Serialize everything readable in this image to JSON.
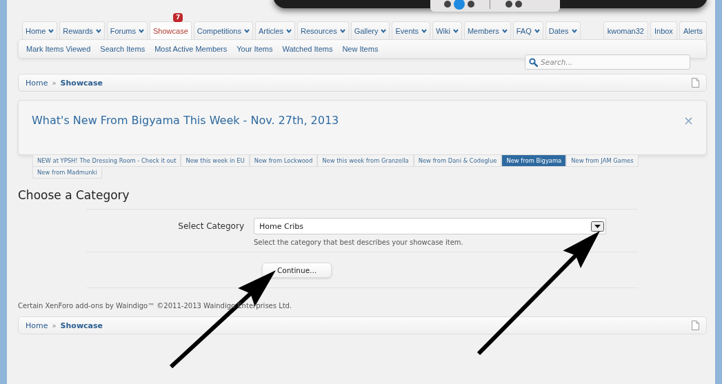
{
  "nav_tabs": [
    {
      "label": "Home",
      "has_menu": true,
      "selected": false
    },
    {
      "label": "Rewards",
      "has_menu": true,
      "selected": false
    },
    {
      "label": "Forums",
      "has_menu": true,
      "selected": false
    },
    {
      "label": "Showcase",
      "has_menu": false,
      "selected": true,
      "badge": "7"
    },
    {
      "label": "Competitions",
      "has_menu": true,
      "selected": false
    },
    {
      "label": "Articles",
      "has_menu": true,
      "selected": false
    },
    {
      "label": "Resources",
      "has_menu": true,
      "selected": false
    },
    {
      "label": "Gallery",
      "has_menu": true,
      "selected": false
    },
    {
      "label": "Events",
      "has_menu": true,
      "selected": false
    },
    {
      "label": "Wiki",
      "has_menu": true,
      "selected": false
    },
    {
      "label": "Members",
      "has_menu": true,
      "selected": false
    },
    {
      "label": "FAQ",
      "has_menu": true,
      "selected": false
    },
    {
      "label": "Dates",
      "has_menu": true,
      "selected": false
    }
  ],
  "account_tabs": [
    "kwoman32",
    "Inbox",
    "Alerts"
  ],
  "sub_nav": [
    "Mark Items Viewed",
    "Search Items",
    "Most Active Members",
    "Your Items",
    "Watched Items",
    "New Items"
  ],
  "search": {
    "placeholder": "Search..."
  },
  "breadcrumb_top": {
    "links": [
      "Home",
      "Showcase"
    ],
    "separator": "»"
  },
  "notice": {
    "title": "What's New From Bigyama This Week - Nov. 27th, 2013",
    "close": "×",
    "tabs": [
      {
        "label": "NEW at YPSH! The Dressing Room - Check it out",
        "selected": false
      },
      {
        "label": "New this week in EU",
        "selected": false
      },
      {
        "label": "New from Lockwood",
        "selected": false
      },
      {
        "label": "New this week from Granzella",
        "selected": false
      },
      {
        "label": "New from Dani & Codeglue",
        "selected": false
      },
      {
        "label": "New from Bigyama",
        "selected": true
      },
      {
        "label": "New from JAM Games",
        "selected": false
      },
      {
        "label": "New from Madmunki",
        "selected": false
      }
    ]
  },
  "form": {
    "heading": "Choose a Category",
    "label": "Select Category",
    "value": "Home Cribs",
    "hint": "Select the category that best describes your showcase item.",
    "button": "Continue..."
  },
  "copyright": "Certain XenForo add-ons by Waindigo™ ©2011-2013 Waindigo Enterprises Ltd.",
  "breadcrumb_bottom": {
    "links": [
      "Home",
      "Showcase"
    ],
    "separator": "»"
  },
  "annotations": [
    {
      "kind": "arrow"
    },
    {
      "kind": "arrow"
    }
  ]
}
